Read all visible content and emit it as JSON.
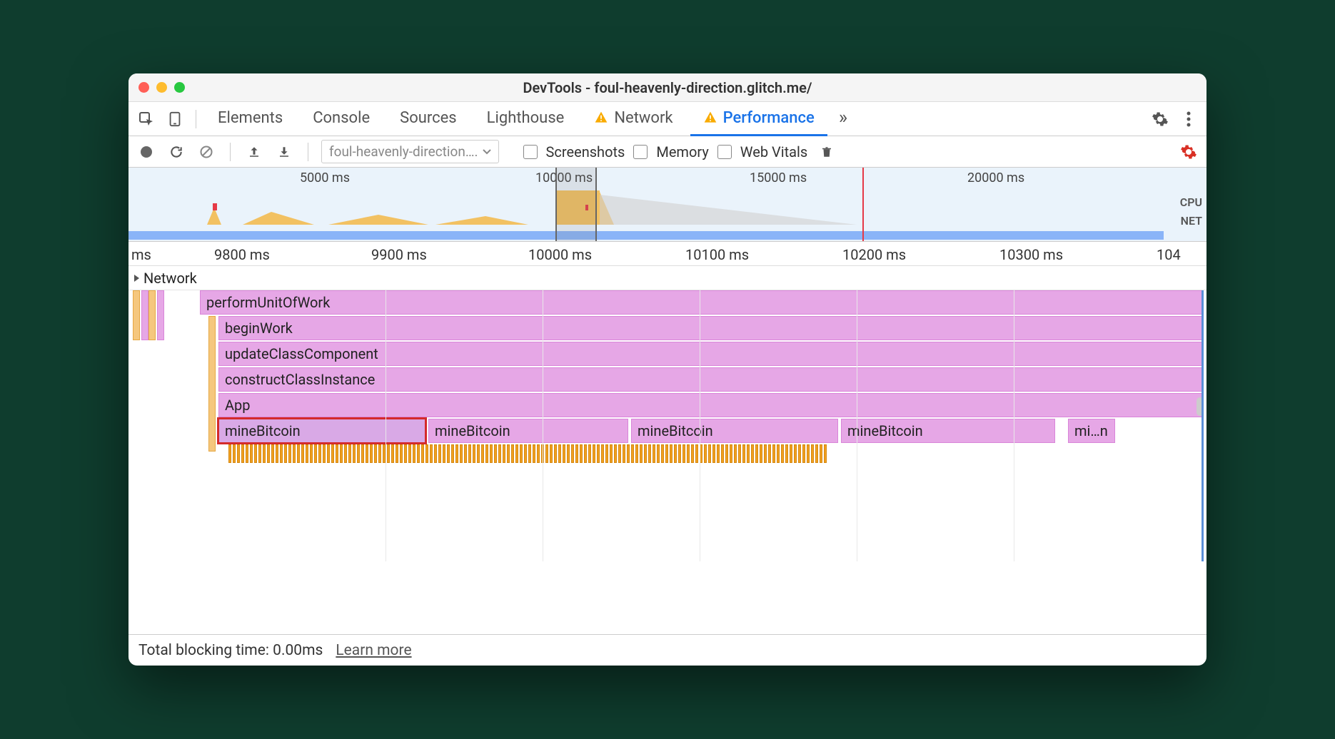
{
  "window": {
    "title": "DevTools - foul-heavenly-direction.glitch.me/"
  },
  "tabs": {
    "items": [
      "Elements",
      "Console",
      "Sources",
      "Lighthouse",
      "Network",
      "Performance"
    ],
    "active": "Performance",
    "warnings": [
      "Network",
      "Performance"
    ],
    "overflow": "»"
  },
  "toolbar": {
    "selector_label": "foul-heavenly-direction….",
    "checkboxes": {
      "screenshots": "Screenshots",
      "memory": "Memory",
      "webvitals": "Web Vitals"
    }
  },
  "overview": {
    "ticks": [
      "5000 ms",
      "10000 ms",
      "15000 ms",
      "20000 ms"
    ],
    "labels": {
      "cpu": "CPU",
      "net": "NET"
    }
  },
  "ruler": {
    "ticks": [
      "ms",
      "9800 ms",
      "9900 ms",
      "10000 ms",
      "10100 ms",
      "10200 ms",
      "10300 ms",
      "104"
    ]
  },
  "sections": {
    "network": "Network"
  },
  "flame": {
    "rows": [
      "performUnitOfWork",
      "beginWork",
      "updateClassComponent",
      "constructClassInstance",
      "App"
    ],
    "calls": [
      "mineBitcoin",
      "mineBitcoin",
      "mineBitcoin",
      "mineBitcoin",
      "mi…n"
    ]
  },
  "footer": {
    "blocking": "Total blocking time: 0.00ms",
    "learn": "Learn more"
  }
}
